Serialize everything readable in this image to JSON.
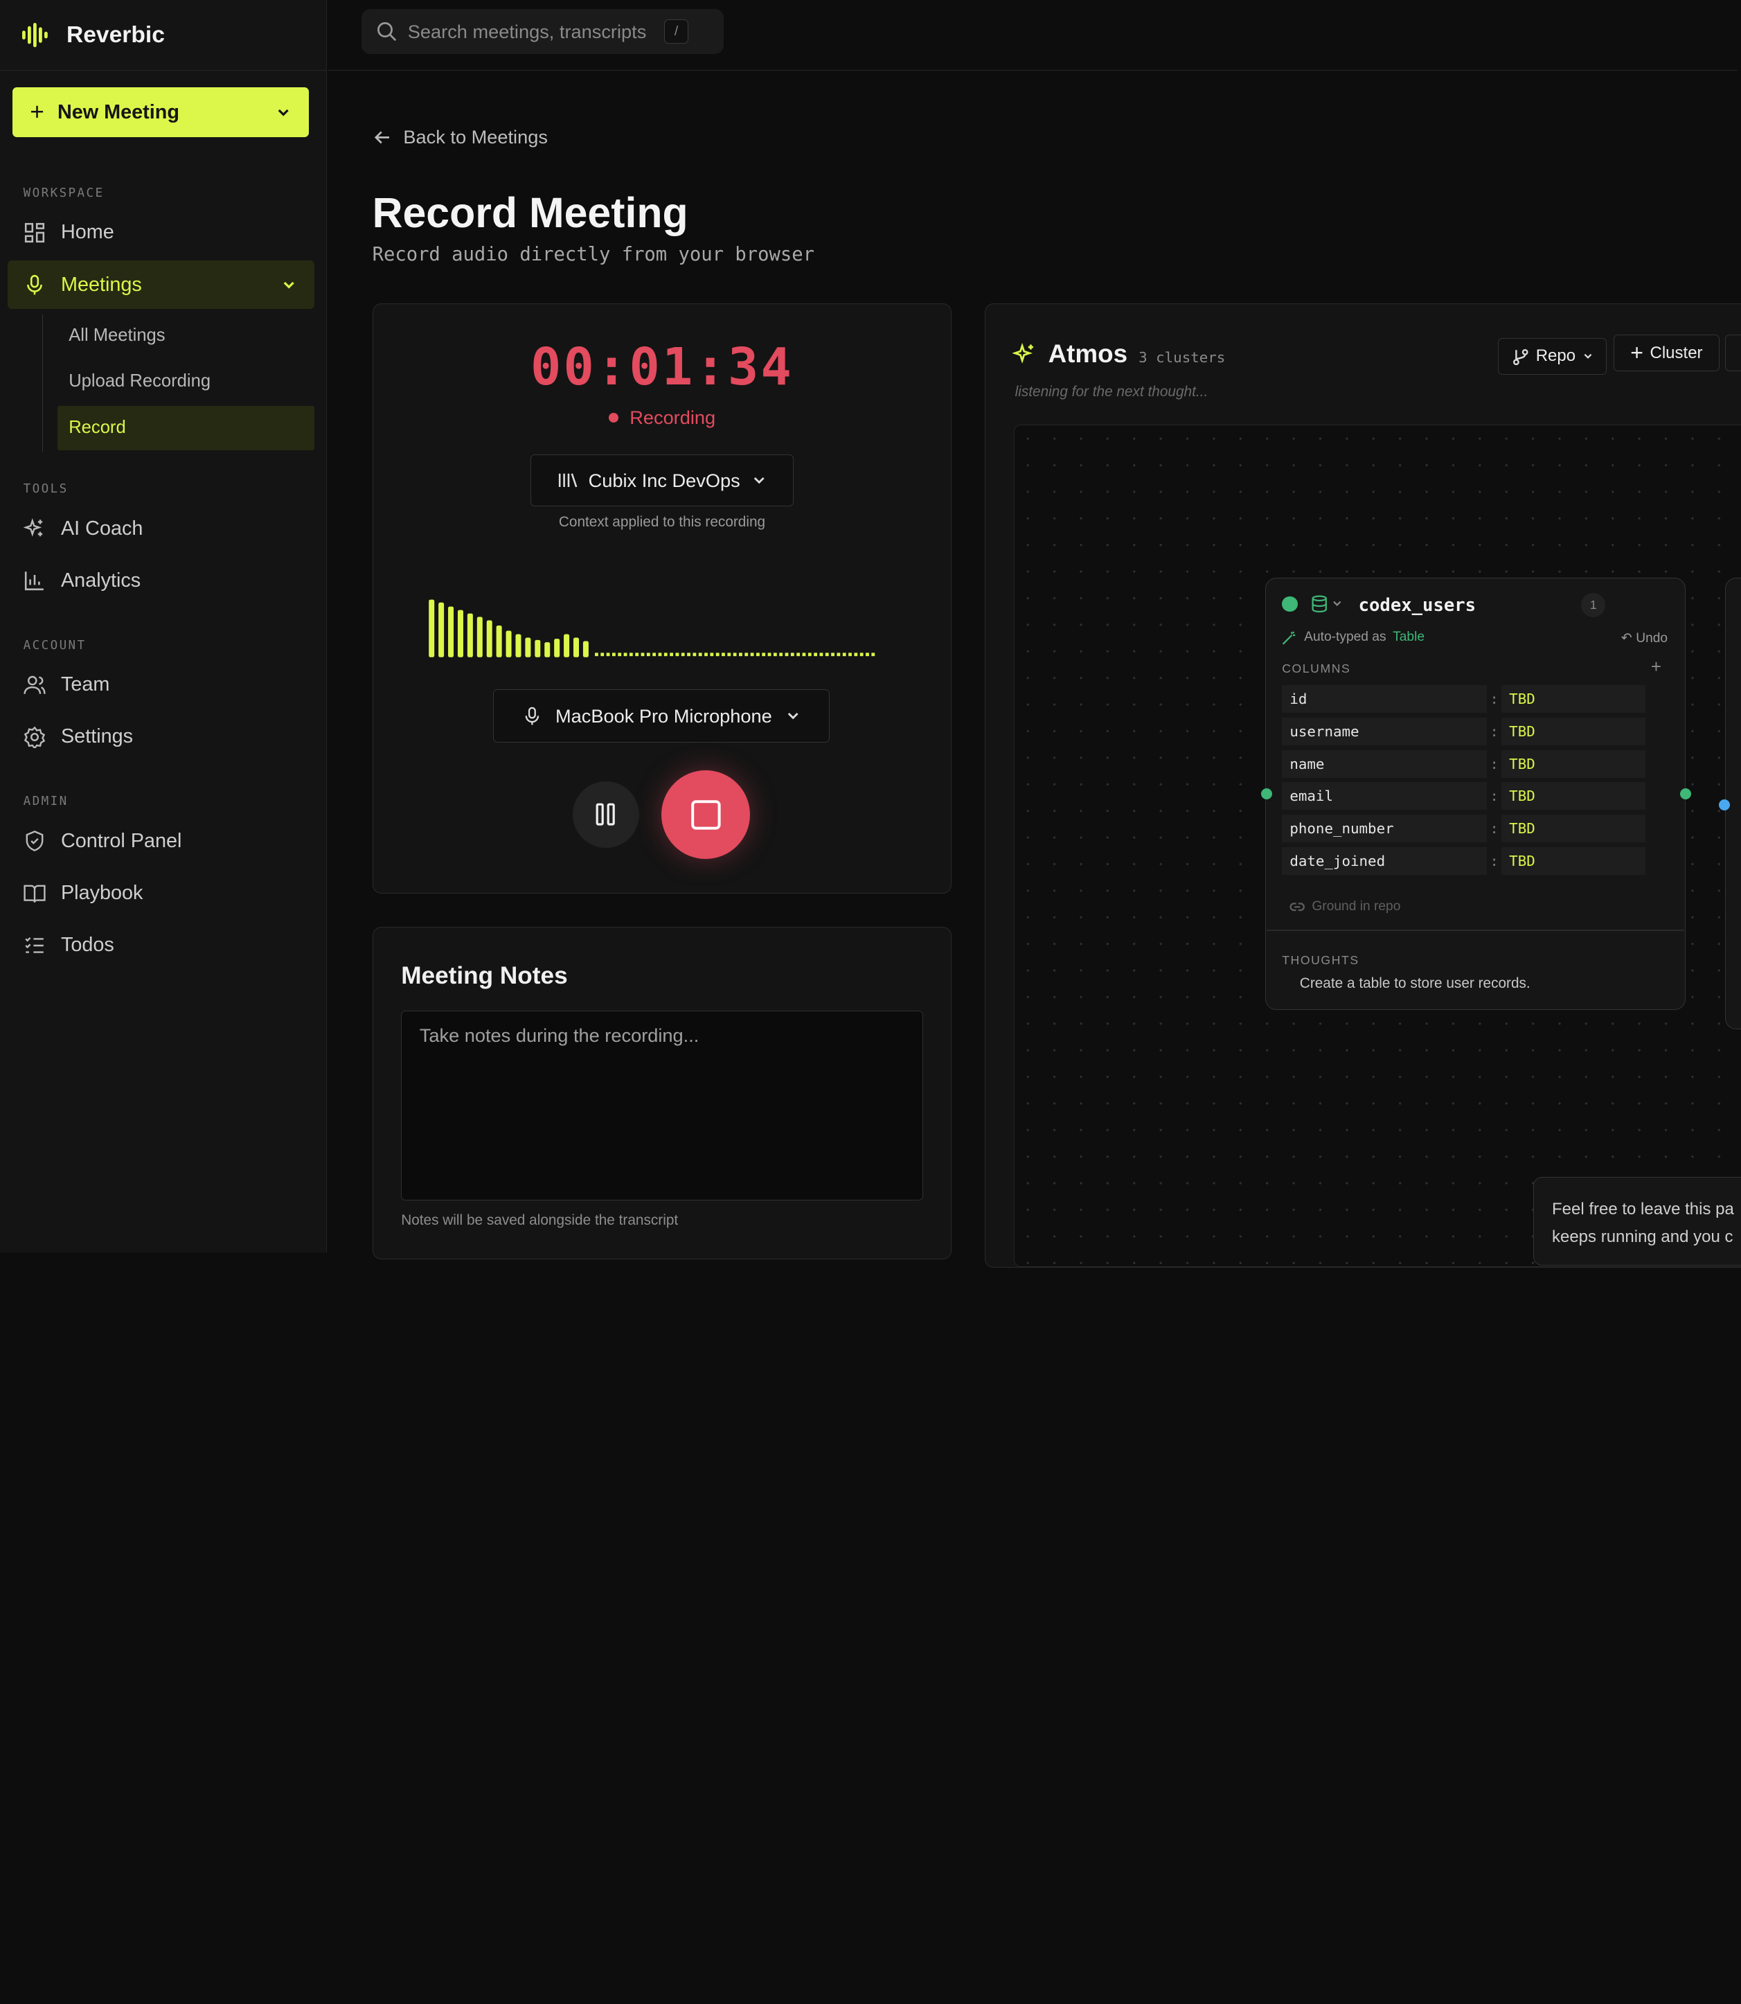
{
  "app": {
    "name": "Reverbic"
  },
  "search": {
    "placeholder": "Search meetings, transcripts",
    "shortcut": "/"
  },
  "sidebar": {
    "new_meeting": "New Meeting",
    "sections": {
      "workspace": "WORKSPACE",
      "tools": "TOOLS",
      "account": "ACCOUNT",
      "admin": "ADMIN"
    },
    "items": {
      "home": "Home",
      "meetings": "Meetings",
      "ai_coach": "AI Coach",
      "analytics": "Analytics",
      "team": "Team",
      "settings": "Settings",
      "control_panel": "Control Panel",
      "playbook": "Playbook",
      "todos": "Todos"
    },
    "meetings_sub": {
      "all": "All Meetings",
      "upload": "Upload Recording",
      "record": "Record"
    }
  },
  "page": {
    "back": "Back to Meetings",
    "title": "Record Meeting",
    "subtitle": "Record audio directly from your browser"
  },
  "recorder": {
    "timer": "00:01:34",
    "status": "Recording",
    "context": "Cubix Inc DevOps",
    "context_note": "Context applied to this recording",
    "microphone": "MacBook Pro Microphone",
    "accent": "#dcf64a",
    "stop_color": "#e34b5f",
    "levels": [
      1.0,
      0.95,
      0.88,
      0.82,
      0.76,
      0.7,
      0.64,
      0.55,
      0.46,
      0.4,
      0.34,
      0.3,
      0.26,
      0.32,
      0.4,
      0.34,
      0.28
    ]
  },
  "notes": {
    "title": "Meeting Notes",
    "placeholder": "Take notes during the recording...",
    "hint": "Notes will be saved alongside the transcript"
  },
  "atmos": {
    "title": "Atmos",
    "clusters": "3 clusters",
    "status": "listening for the next thought...",
    "repo": "Repo",
    "cluster_button": "Cluster",
    "node": {
      "name": "codex_users",
      "badge": "1",
      "auto_typed": "Auto-typed as",
      "type": "Table",
      "undo": "Undo",
      "columns_label": "COLUMNS",
      "columns": [
        {
          "name": "id",
          "type": "TBD"
        },
        {
          "name": "username",
          "type": "TBD"
        },
        {
          "name": "name",
          "type": "TBD"
        },
        {
          "name": "email",
          "type": "TBD"
        },
        {
          "name": "phone_number",
          "type": "TBD"
        },
        {
          "name": "date_joined",
          "type": "TBD"
        }
      ],
      "ground": "Ground in repo",
      "thoughts_label": "THOUGHTS",
      "thought": "Create a table to store user records."
    },
    "toast": {
      "line1": "Feel free to leave this pa",
      "line2": "keeps running and you c"
    }
  }
}
